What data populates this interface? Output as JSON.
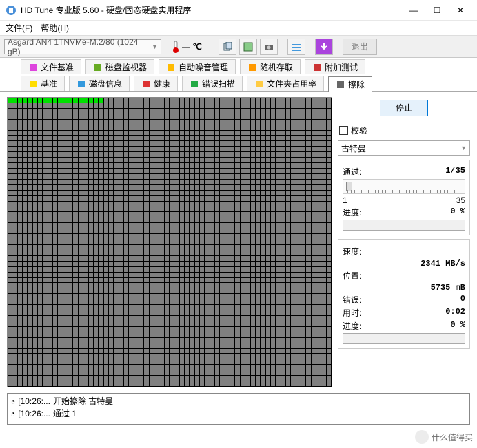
{
  "window": {
    "title": "HD Tune 专业版 5.60 - 硬盘/固态硬盘实用程序"
  },
  "menu": {
    "file": "文件(F)",
    "help": "帮助(H)"
  },
  "toolbar": {
    "drive": "Asgard AN4 1TNVMe-M.2/80 (1024 gB)",
    "temp": "— ℃",
    "exit": "退出"
  },
  "tabs_row1": [
    {
      "label": "文件基准",
      "icon": "file"
    },
    {
      "label": "磁盘监视器",
      "icon": "monitor"
    },
    {
      "label": "自动噪音管理",
      "icon": "speaker"
    },
    {
      "label": "随机存取",
      "icon": "random"
    },
    {
      "label": "附加测试",
      "icon": "extra"
    }
  ],
  "tabs_row2": [
    {
      "label": "基准",
      "icon": "bench"
    },
    {
      "label": "磁盘信息",
      "icon": "info"
    },
    {
      "label": "健康",
      "icon": "health"
    },
    {
      "label": "错误扫描",
      "icon": "scan"
    },
    {
      "label": "文件夹占用率",
      "icon": "folder"
    },
    {
      "label": "擦除",
      "icon": "erase",
      "active": true
    }
  ],
  "side": {
    "stop": "停止",
    "verify": "校验",
    "method": "古特曼",
    "pass_label": "通过:",
    "pass_value": "1/35",
    "scale_min": "1",
    "scale_max": "35",
    "progress1_label": "进度:",
    "progress1_value": "0 %",
    "speed_label": "速度:",
    "speed_value": "2341 MB/s",
    "pos_label": "位置:",
    "pos_value": "5735 mB",
    "err_label": "错误:",
    "err_value": "0",
    "time_label": "用时:",
    "time_value": "0:02",
    "progress2_label": "进度:",
    "progress2_value": "0 %"
  },
  "log": [
    {
      "time": "[10:26:...",
      "text": "开始擦除 古特曼"
    },
    {
      "time": "[10:26:...",
      "text": "通过 1"
    }
  ],
  "watermark": "什么值得买",
  "grid": {
    "total_cells": 3392,
    "done_cells": 19
  }
}
